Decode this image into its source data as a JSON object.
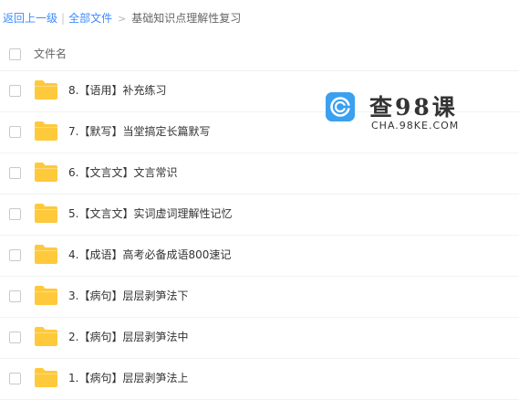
{
  "breadcrumb": {
    "back": "返回上一级",
    "separator": "|",
    "all_files": "全部文件",
    "arrow": ">",
    "current": "基础知识点理解性复习"
  },
  "table": {
    "column_name": "文件名"
  },
  "folders": [
    "8.【语用】补充练习",
    "7.【默写】当堂搞定长篇默写",
    "6.【文言文】文言常识",
    "5.【文言文】实词虚词理解性记忆",
    "4.【成语】高考必备成语800速记",
    "3.【病句】层层剥笋法下",
    "2.【病句】层层剥笋法中",
    "1.【病句】层层剥笋法上"
  ],
  "watermark": {
    "title": "查98课",
    "subtitle": "CHA.98KE.COM"
  },
  "colors": {
    "link": "#3b8cff",
    "folder": "#ffc93c",
    "logo": "#3aa0f0"
  }
}
